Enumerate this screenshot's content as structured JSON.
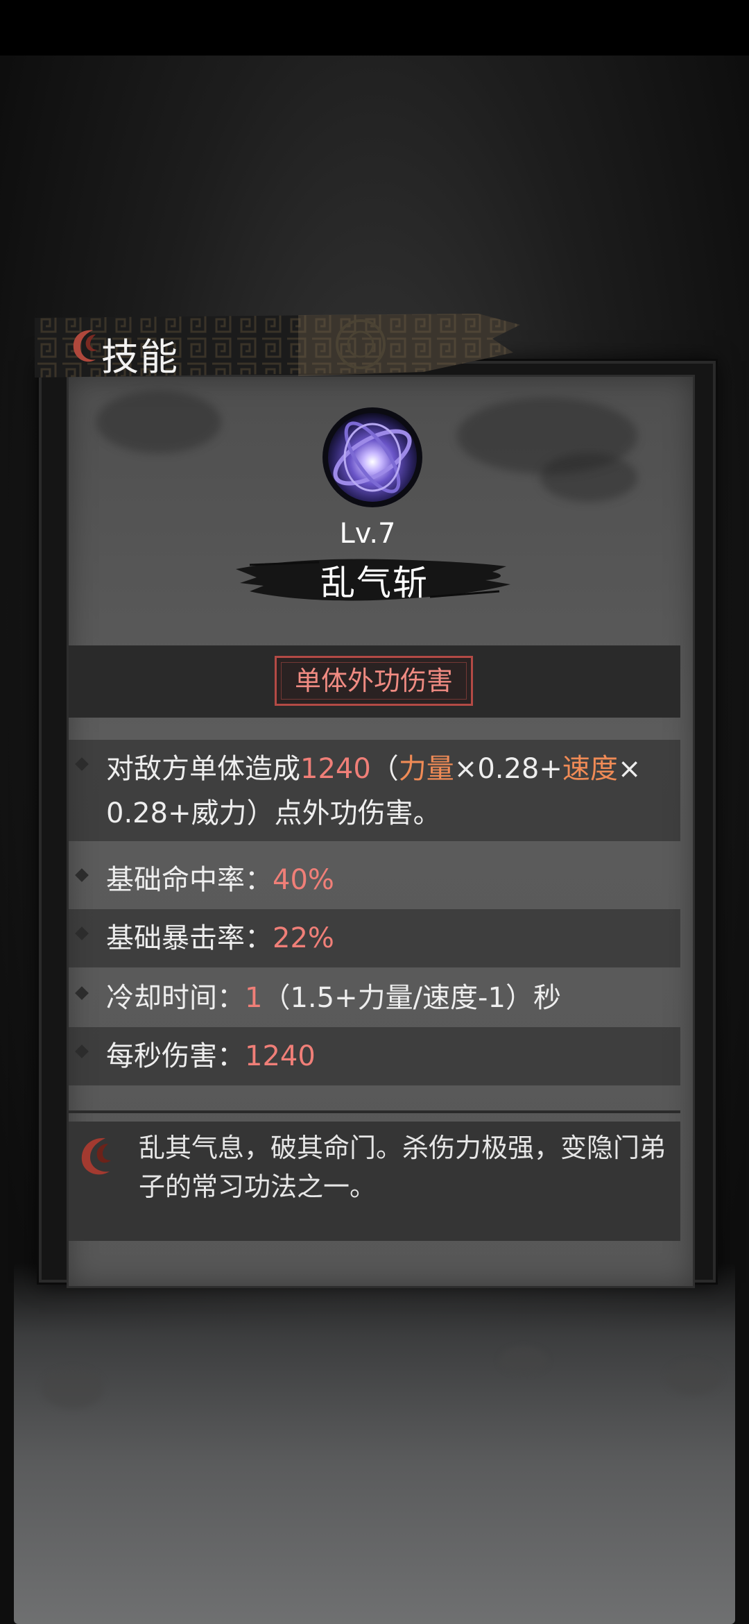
{
  "header": {
    "title": "技能"
  },
  "skill": {
    "level": "Lv.7",
    "name": "乱气斩",
    "type": "单体外功伤害"
  },
  "stats": {
    "damage_line1_prefix": "对敌方单体造成",
    "damage_value": "1240",
    "damage_paren_open": "（",
    "stat_strength": "力量",
    "mult1": "×0.28+",
    "stat_speed": "速度",
    "mult2": "×",
    "damage_line2": "0.28+威力）点外功伤害。",
    "hit_label": "基础命中率：",
    "hit_value": "40%",
    "crit_label": "基础暴击率：",
    "crit_value": "22%",
    "cooldown_label": "冷却时间：",
    "cooldown_value": "1",
    "cooldown_formula": "（1.5+力量/速度-1）秒",
    "dps_label": "每秒伤害：",
    "dps_value": "1240"
  },
  "description": {
    "text": "乱其气息，破其命门。杀伤力极强，变隐门弟子的常习功法之一。"
  },
  "colors": {
    "highlight_red": "#f07f78",
    "highlight_orange": "#f08b56",
    "tag_border": "#b34a45"
  }
}
